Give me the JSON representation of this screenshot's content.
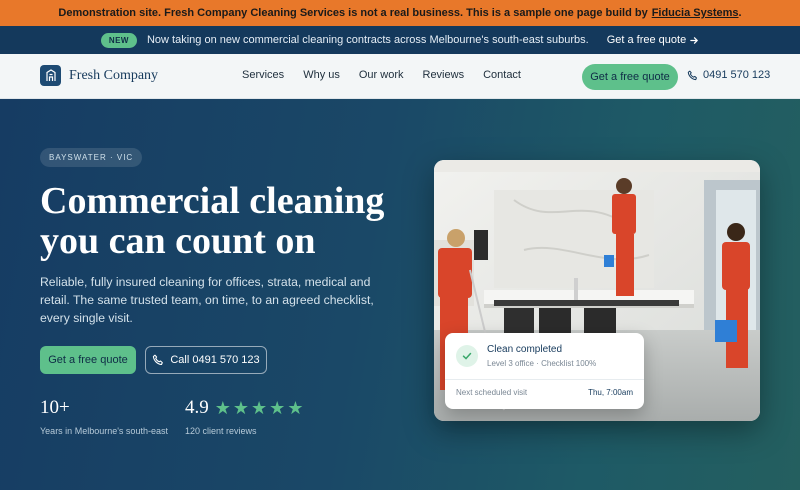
{
  "demo_banner": {
    "text": "Demonstration site. Fresh Company Cleaning Services is not a real business. This is a sample one page build by",
    "link": "Fiducia Systems",
    "suffix": "."
  },
  "announcement": {
    "badge": "NEW",
    "message": "Now taking on new commercial cleaning contracts across Melbourne's south-east suburbs.",
    "link": "Get a free quote"
  },
  "header": {
    "brand": "Fresh Company",
    "nav": [
      "Services",
      "Why us",
      "Our work",
      "Reviews",
      "Contact"
    ],
    "cta": "Get a free quote",
    "phone": "0491 570 123"
  },
  "hero": {
    "location_badge": "BAYSWATER · VIC",
    "title": "Commercial cleaning you can count on",
    "subtitle": "Reliable, fully insured cleaning for offices, strata, medical and retail. The same trusted team, on time, to an agreed checklist, every single visit.",
    "primary_cta": "Get a free quote",
    "secondary_cta": "Call 0491 570 123",
    "stats": [
      {
        "value": "10+",
        "label": "Years in Melbourne's south-east"
      },
      {
        "value": "4.9",
        "label": "120 client reviews",
        "stars": 5
      }
    ]
  },
  "status_card": {
    "title": "Clean completed",
    "detail": "Level 3 office · Checklist 100%",
    "next_label": "Next scheduled visit",
    "next_time": "Thu, 7:00am"
  },
  "colors": {
    "banner": "#e8782a",
    "navy": "#163a5c",
    "accent": "#5ec08b"
  }
}
